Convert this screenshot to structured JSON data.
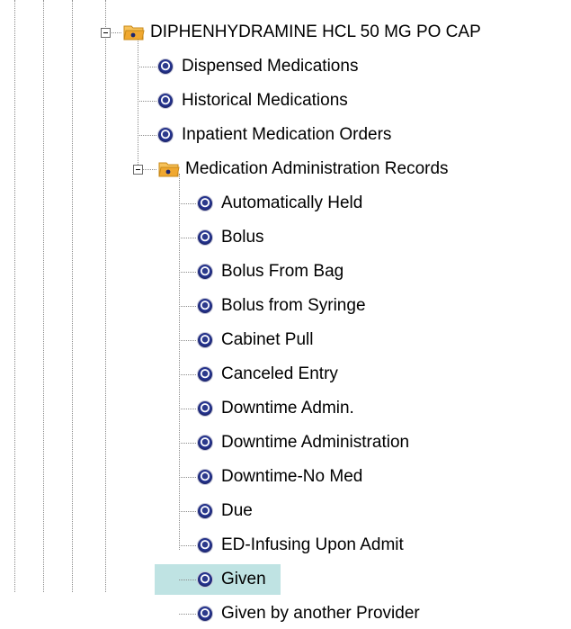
{
  "tree": {
    "root": {
      "label": "DIPHENHYDRAMINE HCL 50 MG PO CAP",
      "icon": "open-folder-icon",
      "expanded": true,
      "children": [
        {
          "label": "Dispensed Medications",
          "icon": "record-bullet-icon"
        },
        {
          "label": "Historical Medications",
          "icon": "record-bullet-icon"
        },
        {
          "label": "Inpatient Medication Orders",
          "icon": "record-bullet-icon"
        }
      ]
    },
    "mar_folder": {
      "label": "Medication Administration Records",
      "icon": "open-folder-icon",
      "expanded": true,
      "items": [
        {
          "label": "Automatically Held"
        },
        {
          "label": "Bolus"
        },
        {
          "label": "Bolus From Bag"
        },
        {
          "label": "Bolus from Syringe"
        },
        {
          "label": "Cabinet Pull"
        },
        {
          "label": "Canceled Entry"
        },
        {
          "label": "Downtime Admin."
        },
        {
          "label": "Downtime Administration"
        },
        {
          "label": "Downtime-No Med"
        },
        {
          "label": "Due"
        },
        {
          "label": "ED-Infusing Upon Admit"
        },
        {
          "label": "Given",
          "selected": true
        },
        {
          "label": "Given by another Provider"
        }
      ]
    },
    "colors": {
      "selection": "#bfe3e3",
      "bullet": "#1c2670",
      "folder": "#f0a830",
      "guide_lines": "#8a8a8a"
    }
  }
}
